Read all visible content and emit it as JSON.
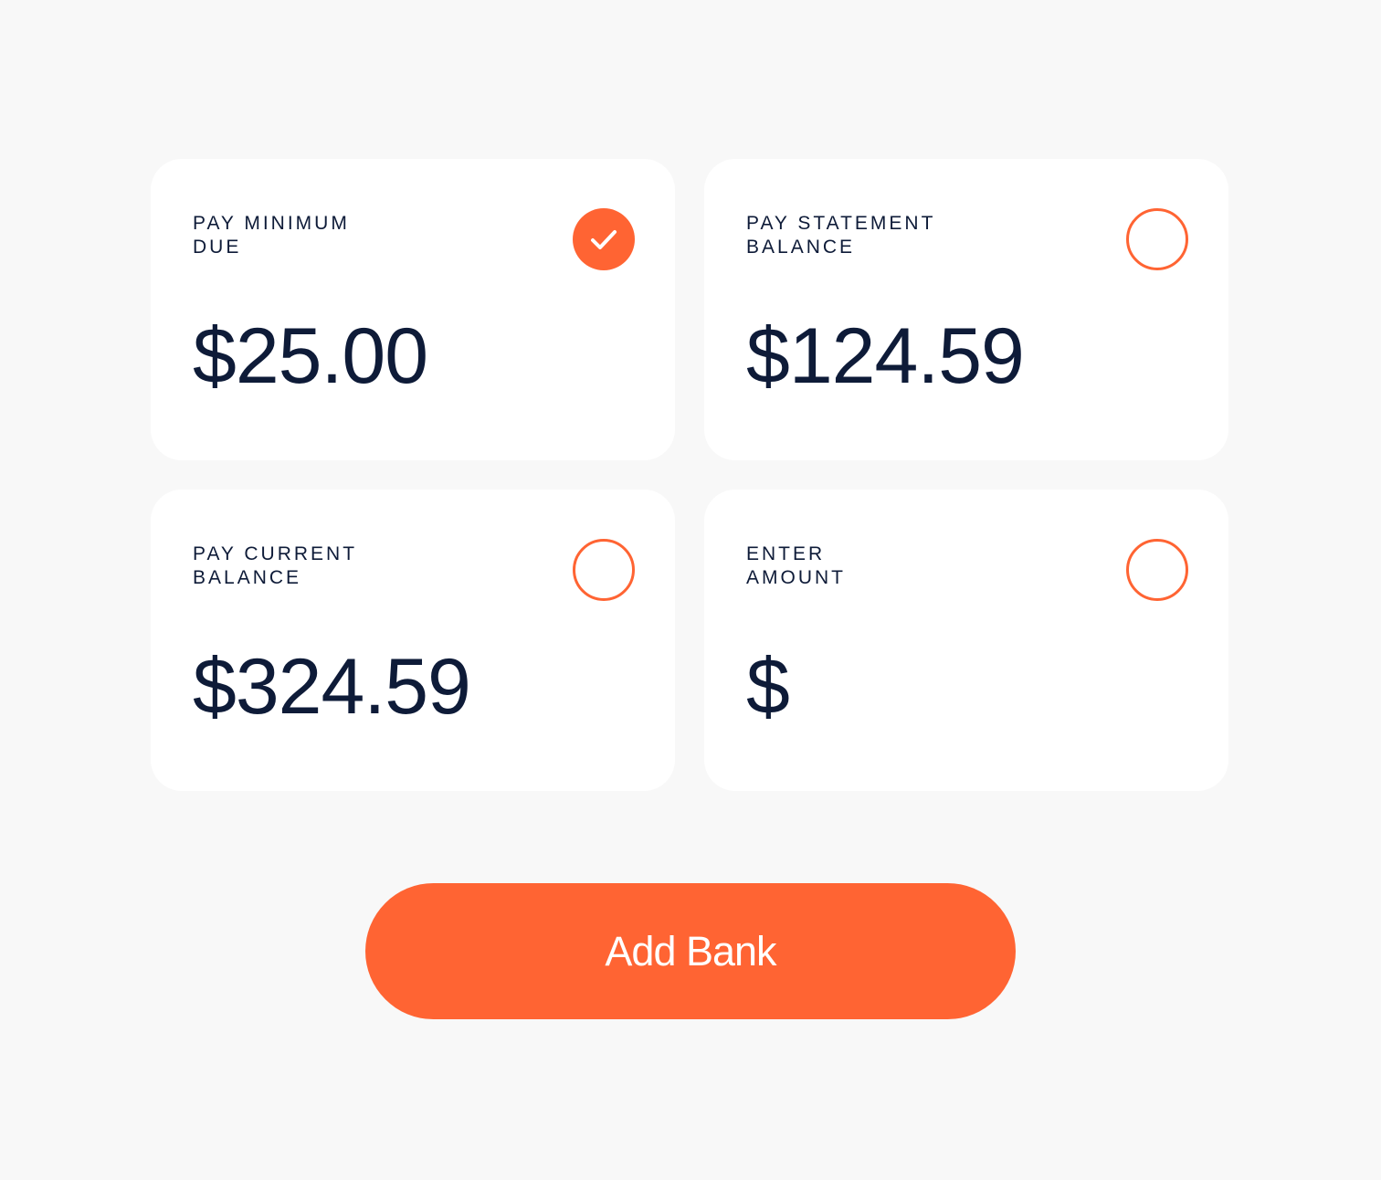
{
  "options": [
    {
      "label_line1": "PAY MINIMUM",
      "label_line2": "DUE",
      "amount": "$25.00",
      "selected": true
    },
    {
      "label_line1": "PAY STATEMENT",
      "label_line2": "BALANCE",
      "amount": "$124.59",
      "selected": false
    },
    {
      "label_line1": "PAY CURRENT",
      "label_line2": "BALANCE",
      "amount": "$324.59",
      "selected": false
    },
    {
      "label_line1": "ENTER",
      "label_line2": "AMOUNT",
      "currency_symbol": "$",
      "input_value": "",
      "selected": false
    }
  ],
  "colors": {
    "accent": "#ff6433",
    "text": "#0e1b38",
    "card_bg": "#ffffff",
    "page_bg": "#f8f8f8"
  },
  "icons": {
    "selected": "checkmark-icon",
    "unselected": "radio-empty-icon"
  },
  "primary_button": {
    "label": "Add Bank"
  }
}
